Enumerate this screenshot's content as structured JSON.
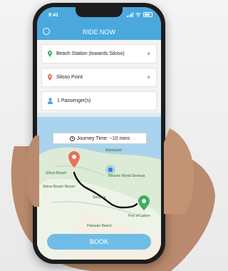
{
  "status_bar": {
    "time": "9:41"
  },
  "header": {
    "title": "RIDE NOW"
  },
  "form": {
    "pickup": {
      "value": "Beach Station (towards Siloso)",
      "pin_color": "#3bb15d"
    },
    "dropoff": {
      "value": "Siloso Point",
      "pin_color": "#e8715a"
    },
    "passengers": {
      "value": "1 Passenger(s)"
    },
    "clear_symbol": "×"
  },
  "map": {
    "journey_time": "Journey Time: ~10 mins",
    "labels": {
      "siloso_beach": "Siloso Beach",
      "siloso_beach_resort": "Siloso Beach Resort",
      "resorts_world": "Resorts World Sentosa",
      "palawan": "Palawan Beach",
      "port_of_lisbon": "Port of Lisbon",
      "sentosa": "Sentosa",
      "waterpark": "Waterpark"
    }
  },
  "book_button": {
    "label": "BOOK"
  },
  "colors": {
    "accent": "#4aa8dd",
    "button": "#6fbde6"
  }
}
